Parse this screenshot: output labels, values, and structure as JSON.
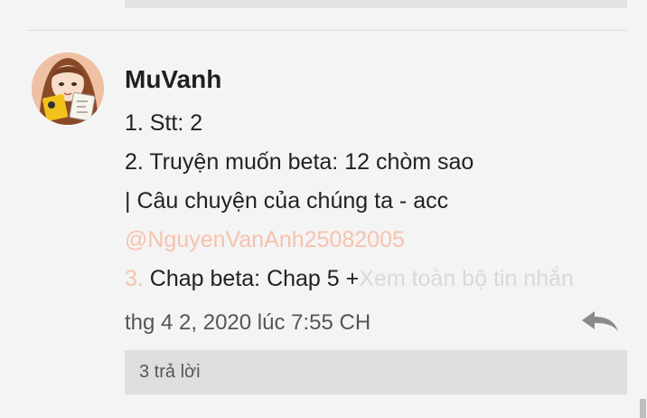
{
  "comment": {
    "username": "MuVanh",
    "lines": [
      "1. Stt: 2",
      "2. Truyện muốn beta: 12 chòm sao",
      "| Câu chuyện của chúng ta - acc",
      "@NguyenVanAnh25082005"
    ],
    "line5_prefix": "3.",
    "line5_text": " Chap beta: Chap 5 +",
    "see_all_label": "Xem toàn bộ tin nhắn",
    "timestamp": "thg 4 2, 2020 lúc 7:55 CH",
    "replies_label": "3 trả lời"
  },
  "icons": {
    "reply": "reply-arrow-icon",
    "avatar": "user-avatar"
  },
  "colors": {
    "mention": "#f6c2ad",
    "see_all": "#d9d9d9",
    "bar": "#dedede"
  }
}
